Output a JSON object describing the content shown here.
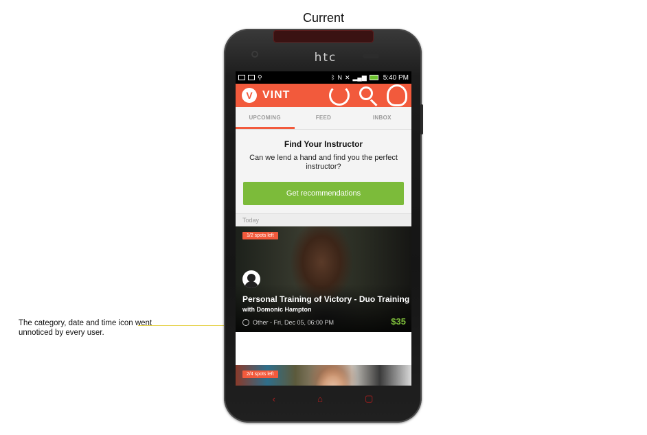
{
  "caption": "Current",
  "annotation": "The category, date and time icon went unnoticed by every user.",
  "device": {
    "brand": "htc"
  },
  "status_bar": {
    "time": "5:40",
    "time_suffix": "PM"
  },
  "app": {
    "logo_letter": "V",
    "name": "VINT"
  },
  "tabs": [
    {
      "label": "UPCOMING",
      "active": true
    },
    {
      "label": "FEED",
      "active": false
    },
    {
      "label": "INBOX",
      "active": false
    }
  ],
  "recommendation": {
    "title": "Find Your Instructor",
    "description": "Can we lend a hand and find you the perfect instructor?",
    "button_label": "Get recommendations"
  },
  "section_label": "Today",
  "cards": [
    {
      "spots": "1/2 spots left",
      "title": "Personal Training of Victory - Duo Training",
      "subtitle": "with Domonic Hampton",
      "meta": "Other - Fri, Dec 05, 06:00 PM",
      "price": "$35"
    },
    {
      "spots": "2/4 spots left"
    }
  ],
  "nav": {
    "back_icon": "‹",
    "home_icon": "⌂",
    "recent_icon": "▢"
  },
  "colors": {
    "accent": "#f25a3c",
    "button_green": "#7cbb3a",
    "price_green": "#7cbb3a"
  }
}
